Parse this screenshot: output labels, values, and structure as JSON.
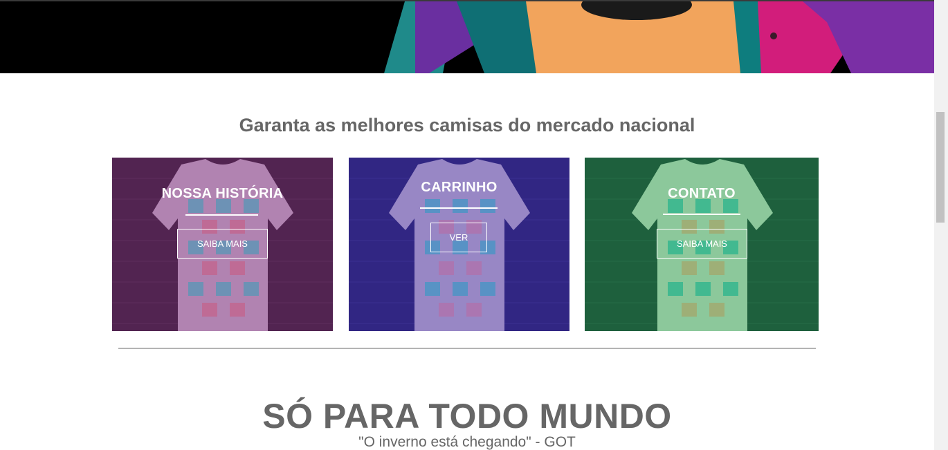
{
  "hero": {
    "image": "person-in-colorful-jacket"
  },
  "section": {
    "title": "Garanta as melhores camisas do mercado nacional"
  },
  "cards": [
    {
      "title": "NOSSA HISTÓRIA",
      "button": "SAIBA MAIS",
      "overlay_color": "#6b2d6b"
    },
    {
      "title": "CARRINHO",
      "button": "VER",
      "overlay_color": "#3a2a8a"
    },
    {
      "title": "CONTATO",
      "button": "SAIBA MAIS",
      "overlay_color": "#1f7a4a"
    }
  ],
  "feature": {
    "title": "SÓ PARA TODO MUNDO",
    "quote": "\"O inverno está chegando\" - GOT"
  },
  "colors": {
    "text_gray": "#666666",
    "divider": "#b3b3b3"
  }
}
